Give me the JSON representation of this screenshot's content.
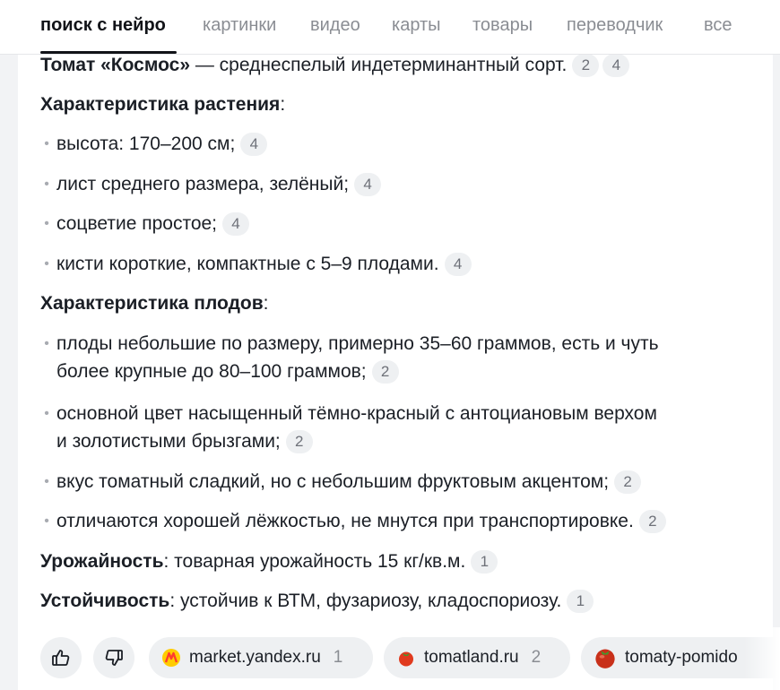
{
  "tabs": [
    {
      "label": "поиск с нейро",
      "active": true
    },
    {
      "label": "картинки"
    },
    {
      "label": "видео"
    },
    {
      "label": "карты"
    },
    {
      "label": "товары"
    },
    {
      "label": "переводчик"
    },
    {
      "label": "все"
    }
  ],
  "answer": {
    "intro": {
      "bold": "Томат «Космос»",
      "text": " — среднеспелый индетерминантный сорт.",
      "refs": [
        "2",
        "4"
      ]
    },
    "plant": {
      "heading": "Характеристика растения",
      "colon": ":",
      "items": [
        {
          "text": "высота: 170–200 см;",
          "ref": "4"
        },
        {
          "text": "лист среднего размера, зелёный;",
          "ref": "4"
        },
        {
          "text": "соцветие простое;",
          "ref": "4"
        },
        {
          "text": "кисти короткие, компактные с 5–9 плодами.",
          "ref": "4"
        }
      ]
    },
    "fruit": {
      "heading": "Характеристика плодов",
      "colon": ":",
      "items": [
        {
          "line1": "плоды небольшие по размеру, примерно 35–60 граммов, есть и чуть",
          "line2": "более крупные до 80–100 граммов;",
          "ref": "2"
        },
        {
          "line1": "основной цвет насыщенный тёмно-красный с антоциановым верхом",
          "line2": "и золотистыми брызгами;",
          "ref": "2"
        },
        {
          "text": "вкус томатный сладкий, но с небольшим фруктовым акцентом;",
          "ref": "2"
        },
        {
          "text": "отличаются хорошей лёжкостью, не мнутся при транспортировке.",
          "ref": "2"
        }
      ]
    },
    "yield": {
      "bold": "Урожайность",
      "text": ": товарная урожайность 15 кг/кв.м.",
      "ref": "1"
    },
    "resistance": {
      "bold": "Устойчивость",
      "text": ": устойчив к ВТМ, фузариозу, кладоспориозу.",
      "ref": "1"
    }
  },
  "footer": {
    "like_icon": "thumbs-up-icon",
    "dislike_icon": "thumbs-down-icon",
    "sources": [
      {
        "domain": "market.yandex.ru",
        "num": "1",
        "icon": "market-logo-icon"
      },
      {
        "domain": "tomatland.ru",
        "num": "2",
        "icon": "tomato-icon"
      },
      {
        "domain": "tomaty-pomido",
        "num": "",
        "icon": "tomato-icon"
      }
    ]
  },
  "colors": {
    "accent": "#111318",
    "chip_bg": "#eef0f2",
    "muted": "#8a8d93"
  }
}
